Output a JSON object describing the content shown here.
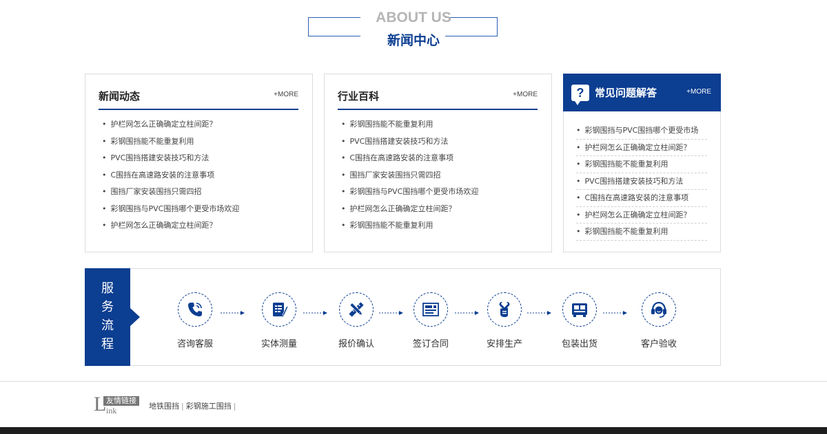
{
  "header": {
    "en_title": "ABOUT US",
    "cn_title": "新闻中心"
  },
  "news": {
    "title": "新闻动态",
    "more": "+MORE",
    "items": [
      "护栏网怎么正确确定立柱间距？",
      "彩钢围挡能不能重复利用",
      "PVC围挡搭建安装技巧和方法",
      "C围挡在高速路安装的注意事项",
      "围挡厂家安装围挡只需四招",
      "彩钢围挡与PVC围挡哪个更受市场欢迎",
      "护栏网怎么正确确定立柱间距？"
    ]
  },
  "industry": {
    "title": "行业百科",
    "more": "+MORE",
    "items": [
      "彩钢围挡能不能重复利用",
      "PVC围挡搭建安装技巧和方法",
      "C围挡在高速路安装的注意事项",
      "围挡厂家安装围挡只需四招",
      "彩钢围挡与PVC围挡哪个更受市场欢迎",
      "护栏网怎么正确确定立柱间距？",
      "彩钢围挡能不能重复利用"
    ]
  },
  "faq": {
    "title": "常见问题解答",
    "more": "+MORE",
    "icon": "question-icon",
    "items": [
      "彩钢围挡与PVC围挡哪个更受市场",
      "护栏网怎么正确确定立柱间距？",
      "彩钢围挡能不能重复利用",
      "PVC围挡搭建安装技巧和方法",
      "C围挡在高速路安装的注意事项",
      "护栏网怎么正确确定立柱间距？",
      "彩钢围挡能不能重复利用"
    ]
  },
  "flow": {
    "side_title": "服务流程",
    "steps": [
      {
        "label": "咨询客服",
        "icon": "phone-icon"
      },
      {
        "label": "实体测量",
        "icon": "clipboard-icon"
      },
      {
        "label": "报价确认",
        "icon": "ruler-pencil-icon"
      },
      {
        "label": "签订合同",
        "icon": "contract-icon"
      },
      {
        "label": "安排生产",
        "icon": "wrench-hand-icon"
      },
      {
        "label": "包装出货",
        "icon": "truck-icon"
      },
      {
        "label": "客户验收",
        "icon": "headset-icon"
      }
    ]
  },
  "friends": {
    "tag": "友情链接",
    "big_letter": "L",
    "small_word": "ink",
    "links": [
      "地铁围挡",
      "彩钢施工围挡"
    ],
    "separator": "|"
  },
  "colors": {
    "brand": "#0c3e91",
    "header_en": "#b5b5b5"
  }
}
